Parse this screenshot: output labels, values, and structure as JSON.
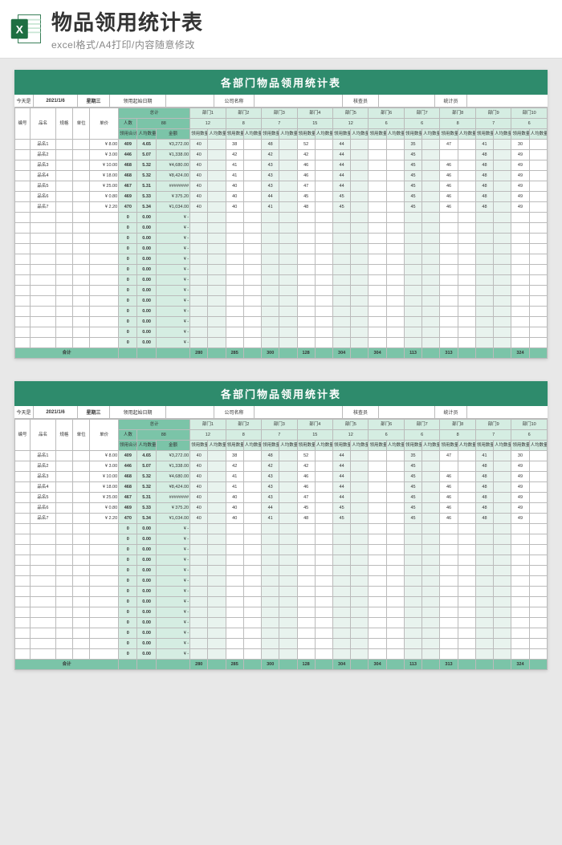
{
  "header": {
    "title": "物品领用统计表",
    "subtitle": "excel格式/A4打印/内容随意修改"
  },
  "sheet": {
    "title": "各部门物品领用统计表",
    "info": {
      "today_label": "今天是",
      "date": "2021/1/6",
      "weekday": "星期三",
      "start_date_label": "领用起始日期",
      "start_date": "",
      "company_label": "公司名称",
      "company": "",
      "inspector_label": "核查员",
      "inspector": "",
      "stat_label": "统计员",
      "stat": ""
    },
    "cols": {
      "no": "编号",
      "name": "品名",
      "spec": "规格",
      "unit": "单位",
      "price": "单价",
      "total": "总计",
      "people": "人数",
      "people_total": "88",
      "qty_sum": "领用合计",
      "avg": "人均数量",
      "amount": "金额",
      "dept_prefix": "部门",
      "dept_people": [
        "12",
        "8",
        "7",
        "15",
        "12",
        "6",
        "6",
        "8",
        "7",
        "6"
      ],
      "dept_sub1": "领用数量",
      "dept_sub2": "人均数量"
    },
    "rows": [
      {
        "name": "品名1",
        "price": "¥  8.00",
        "sum": "409",
        "avg": "4.65",
        "amt": "¥3,272.00",
        "d": [
          "40",
          "",
          "38",
          "",
          "48",
          "",
          "52",
          "",
          "44",
          "",
          "",
          "",
          "35",
          "",
          "47",
          "",
          "41",
          "",
          "30",
          ""
        ]
      },
      {
        "name": "品名2",
        "price": "¥  3.00",
        "sum": "446",
        "avg": "5.07",
        "amt": "¥1,338.00",
        "d": [
          "40",
          "",
          "42",
          "",
          "42",
          "",
          "42",
          "",
          "44",
          "",
          "",
          "",
          "45",
          "",
          "",
          "",
          "48",
          "",
          "49",
          ""
        ]
      },
      {
        "name": "品名3",
        "price": "¥ 10.00",
        "sum": "468",
        "avg": "5.32",
        "amt": "¥4,680.00",
        "d": [
          "40",
          "",
          "41",
          "",
          "43",
          "",
          "46",
          "",
          "44",
          "",
          "",
          "",
          "45",
          "",
          "46",
          "",
          "48",
          "",
          "49",
          ""
        ]
      },
      {
        "name": "品名4",
        "price": "¥ 18.00",
        "sum": "468",
        "avg": "5.32",
        "amt": "¥8,424.00",
        "d": [
          "40",
          "",
          "41",
          "",
          "43",
          "",
          "46",
          "",
          "44",
          "",
          "",
          "",
          "45",
          "",
          "46",
          "",
          "48",
          "",
          "49",
          ""
        ]
      },
      {
        "name": "品名5",
        "price": "¥ 25.00",
        "sum": "467",
        "avg": "5.31",
        "amt": "########",
        "d": [
          "40",
          "",
          "40",
          "",
          "43",
          "",
          "47",
          "",
          "44",
          "",
          "",
          "",
          "45",
          "",
          "46",
          "",
          "48",
          "",
          "49",
          ""
        ]
      },
      {
        "name": "品名6",
        "price": "¥  0.80",
        "sum": "469",
        "avg": "5.33",
        "amt": "¥  375.20",
        "d": [
          "40",
          "",
          "40",
          "",
          "44",
          "",
          "45",
          "",
          "45",
          "",
          "",
          "",
          "45",
          "",
          "46",
          "",
          "48",
          "",
          "49",
          ""
        ]
      },
      {
        "name": "品名7",
        "price": "¥  2.20",
        "sum": "470",
        "avg": "5.34",
        "amt": "¥1,034.00",
        "d": [
          "40",
          "",
          "40",
          "",
          "41",
          "",
          "48",
          "",
          "45",
          "",
          "",
          "",
          "45",
          "",
          "46",
          "",
          "48",
          "",
          "49",
          ""
        ]
      }
    ],
    "empty_row": {
      "sum": "0",
      "avg": "0.00",
      "amt": "¥       -"
    },
    "empty_count": 13,
    "total_label": "合计",
    "dept_totals": [
      "280",
      "",
      "285",
      "",
      "300",
      "",
      "128",
      "",
      "304",
      "",
      "304",
      "",
      "113",
      "",
      "313",
      "",
      "",
      "",
      "324",
      ""
    ]
  },
  "chart_data": {
    "type": "table",
    "title": "各部门物品领用统计表",
    "date": "2021/1/6",
    "weekday": "星期三",
    "total_people": 88,
    "departments": [
      {
        "name": "部门1",
        "people": 12,
        "total_qty": 280
      },
      {
        "name": "部门2",
        "people": 8,
        "total_qty": 285
      },
      {
        "name": "部门3",
        "people": 7,
        "total_qty": 300
      },
      {
        "name": "部门4",
        "people": 15,
        "total_qty": 128
      },
      {
        "name": "部门5",
        "people": 12,
        "total_qty": 304
      },
      {
        "name": "部门6",
        "people": 6,
        "total_qty": 304
      },
      {
        "name": "部门7",
        "people": 6,
        "total_qty": 113
      },
      {
        "name": "部门8",
        "people": 8,
        "total_qty": 313
      },
      {
        "name": "部门9",
        "people": 7,
        "total_qty": null
      },
      {
        "name": "部门10",
        "people": 6,
        "total_qty": 324
      }
    ],
    "items": [
      {
        "name": "品名1",
        "price": 8.0,
        "qty_sum": 409,
        "avg": 4.65,
        "amount": 3272.0,
        "dept_qty": [
          40,
          38,
          48,
          52,
          44,
          null,
          35,
          47,
          41,
          30
        ]
      },
      {
        "name": "品名2",
        "price": 3.0,
        "qty_sum": 446,
        "avg": 5.07,
        "amount": 1338.0,
        "dept_qty": [
          40,
          42,
          42,
          42,
          44,
          null,
          45,
          null,
          48,
          49
        ]
      },
      {
        "name": "品名3",
        "price": 10.0,
        "qty_sum": 468,
        "avg": 5.32,
        "amount": 4680.0,
        "dept_qty": [
          40,
          41,
          43,
          46,
          44,
          null,
          45,
          46,
          48,
          49
        ]
      },
      {
        "name": "品名4",
        "price": 18.0,
        "qty_sum": 468,
        "avg": 5.32,
        "amount": 8424.0,
        "dept_qty": [
          40,
          41,
          43,
          46,
          44,
          null,
          45,
          46,
          48,
          49
        ]
      },
      {
        "name": "品名5",
        "price": 25.0,
        "qty_sum": 467,
        "avg": 5.31,
        "amount": null,
        "dept_qty": [
          40,
          40,
          43,
          47,
          44,
          null,
          45,
          46,
          48,
          49
        ]
      },
      {
        "name": "品名6",
        "price": 0.8,
        "qty_sum": 469,
        "avg": 5.33,
        "amount": 375.2,
        "dept_qty": [
          40,
          40,
          44,
          45,
          45,
          null,
          45,
          46,
          48,
          49
        ]
      },
      {
        "name": "品名7",
        "price": 2.2,
        "qty_sum": 470,
        "avg": 5.34,
        "amount": 1034.0,
        "dept_qty": [
          40,
          40,
          41,
          48,
          45,
          null,
          45,
          46,
          48,
          49
        ]
      }
    ]
  }
}
